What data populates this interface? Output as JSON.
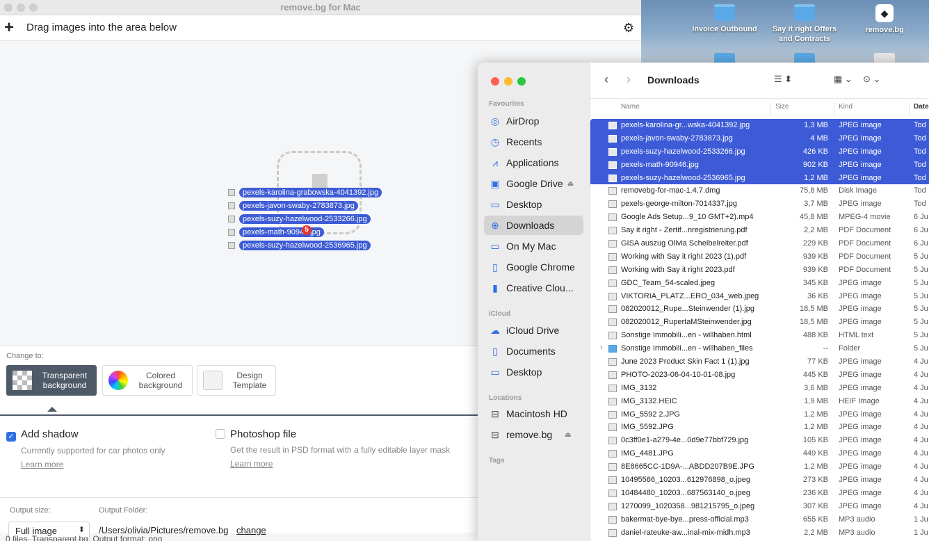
{
  "app": {
    "window_title": "remove.bg for Mac",
    "drag_prompt": "Drag images into the area below",
    "drag_items": [
      "pexels-karolina-grabowska-4041392.jpg",
      "pexels-javon-swaby-2783873.jpg",
      "pexels-suzy-hazelwood-2533266.jpg",
      "pexels-math-90946.jpg",
      "pexels-suzy-hazelwood-2536965.jpg"
    ],
    "drag_count": "5",
    "change_to": "Change to:",
    "options": {
      "transparent": "Transparent background",
      "colored": "Colored background",
      "design": "Design Template"
    },
    "shadow": {
      "title": "Add shadow",
      "desc": "Currently supported for car photos only",
      "link": "Learn more",
      "checked": true
    },
    "psd": {
      "title": "Photoshop file",
      "desc": "Get the result in PSD format with a fully editable layer mask",
      "link": "Learn more",
      "checked": false
    },
    "output_size_label": "Output size:",
    "output_size_value": "Full image",
    "output_folder_label": "Output Folder:",
    "output_folder_value": "/Users/olivia/Pictures/remove.bg",
    "change_link": "change",
    "status": "0 files, Transparent bg, Output format: png"
  },
  "desktop": {
    "icons": [
      "Invoice Outbound",
      "Say it right Offers and Contracts",
      "remove.bg"
    ]
  },
  "finder": {
    "title": "Downloads",
    "sections": {
      "favourites": "Favourites",
      "icloud": "iCloud",
      "locations": "Locations",
      "tags": "Tags"
    },
    "sidebar": {
      "favourites": [
        "AirDrop",
        "Recents",
        "Applications",
        "Google Drive",
        "Desktop",
        "Downloads",
        "On My Mac",
        "Google Chrome",
        "Creative Clou..."
      ],
      "icloud": [
        "iCloud Drive",
        "Documents",
        "Desktop"
      ],
      "locations": [
        "Macintosh HD",
        "remove.bg"
      ]
    },
    "columns": {
      "name": "Name",
      "size": "Size",
      "kind": "Kind",
      "date": "Date"
    },
    "files": [
      {
        "name": "pexels-karolina-gr...wska-4041392.jpg",
        "size": "1,3 MB",
        "kind": "JPEG image",
        "date": "Tod"
      },
      {
        "name": "pexels-javon-swaby-2783873.jpg",
        "size": "4 MB",
        "kind": "JPEG image",
        "date": "Tod"
      },
      {
        "name": "pexels-suzy-hazelwood-2533266.jpg",
        "size": "426 KB",
        "kind": "JPEG image",
        "date": "Tod"
      },
      {
        "name": "pexels-math-90946.jpg",
        "size": "902 KB",
        "kind": "JPEG image",
        "date": "Tod"
      },
      {
        "name": "pexels-suzy-hazelwood-2536965.jpg",
        "size": "1,2 MB",
        "kind": "JPEG image",
        "date": "Tod"
      },
      {
        "name": "removebg-for-mac-1.4.7.dmg",
        "size": "75,8 MB",
        "kind": "Disk Image",
        "date": "Tod"
      },
      {
        "name": "pexels-george-milton-7014337.jpg",
        "size": "3,7 MB",
        "kind": "JPEG image",
        "date": "Tod"
      },
      {
        "name": "Google Ads Setup...9_10 GMT+2).mp4",
        "size": "45,8 MB",
        "kind": "MPEG-4 movie",
        "date": "6 Ju"
      },
      {
        "name": "Say it right - Zertif...nregistrierung.pdf",
        "size": "2,2 MB",
        "kind": "PDF Document",
        "date": "6 Ju"
      },
      {
        "name": "GISA auszug Olivia Scheibelreiter.pdf",
        "size": "229 KB",
        "kind": "PDF Document",
        "date": "6 Ju"
      },
      {
        "name": "Working with Say it right 2023 (1).pdf",
        "size": "939 KB",
        "kind": "PDF Document",
        "date": "5 Ju"
      },
      {
        "name": "Working with Say it right 2023.pdf",
        "size": "939 KB",
        "kind": "PDF Document",
        "date": "5 Ju"
      },
      {
        "name": "GDC_Team_54-scaled.jpeg",
        "size": "345 KB",
        "kind": "JPEG image",
        "date": "5 Ju"
      },
      {
        "name": "VIKTORIA_PLATZ...ERO_034_web.jpeg",
        "size": "36 KB",
        "kind": "JPEG image",
        "date": "5 Ju"
      },
      {
        "name": "082020012_Rupe...Steinwender (1).jpg",
        "size": "18,5 MB",
        "kind": "JPEG image",
        "date": "5 Ju"
      },
      {
        "name": "082020012_RupertaMSteinwender.jpg",
        "size": "18,5 MB",
        "kind": "JPEG image",
        "date": "5 Ju"
      },
      {
        "name": "Sonstige Immobili...en - willhaben.html",
        "size": "488 KB",
        "kind": "HTML text",
        "date": "5 Ju"
      },
      {
        "name": "Sonstige Immobili...en - willhaben_files",
        "size": "--",
        "kind": "Folder",
        "date": "5 Ju"
      },
      {
        "name": "June 2023 Product Skin Fact 1 (1).jpg",
        "size": "77 KB",
        "kind": "JPEG image",
        "date": "4 Ju"
      },
      {
        "name": "PHOTO-2023-06-04-10-01-08.jpg",
        "size": "445 KB",
        "kind": "JPEG image",
        "date": "4 Ju"
      },
      {
        "name": "IMG_3132",
        "size": "3,6 MB",
        "kind": "JPEG image",
        "date": "4 Ju"
      },
      {
        "name": "IMG_3132.HEIC",
        "size": "1,9 MB",
        "kind": "HEIF Image",
        "date": "4 Ju"
      },
      {
        "name": "IMG_5592 2.JPG",
        "size": "1,2 MB",
        "kind": "JPEG image",
        "date": "4 Ju"
      },
      {
        "name": "IMG_5592.JPG",
        "size": "1,2 MB",
        "kind": "JPEG image",
        "date": "4 Ju"
      },
      {
        "name": "0c3ff0e1-a279-4e...0d9e77bbf729.jpg",
        "size": "105 KB",
        "kind": "JPEG image",
        "date": "4 Ju"
      },
      {
        "name": "IMG_4481.JPG",
        "size": "449 KB",
        "kind": "JPEG image",
        "date": "4 Ju"
      },
      {
        "name": "8E8665CC-1D9A-...ABDD207B9E.JPG",
        "size": "1,2 MB",
        "kind": "JPEG image",
        "date": "4 Ju"
      },
      {
        "name": "10495566_10203...612976898_o.jpeg",
        "size": "273 KB",
        "kind": "JPEG image",
        "date": "4 Ju"
      },
      {
        "name": "10484480_10203...687563140_o.jpeg",
        "size": "236 KB",
        "kind": "JPEG image",
        "date": "4 Ju"
      },
      {
        "name": "1270099_1020358...981215795_o.jpeg",
        "size": "307 KB",
        "kind": "JPEG image",
        "date": "4 Ju"
      },
      {
        "name": "bakermat-bye-bye...press-official.mp3",
        "size": "655 KB",
        "kind": "MP3 audio",
        "date": "1 Ju"
      },
      {
        "name": "daniel-rateuke-aw...inal-mix-midh.mp3",
        "size": "2,2 MB",
        "kind": "MP3 audio",
        "date": "1 Ju"
      }
    ]
  },
  "colors": {
    "selection": "#3d5bd6",
    "accent": "#2f6fe4",
    "option_active": "#4e5a67"
  }
}
